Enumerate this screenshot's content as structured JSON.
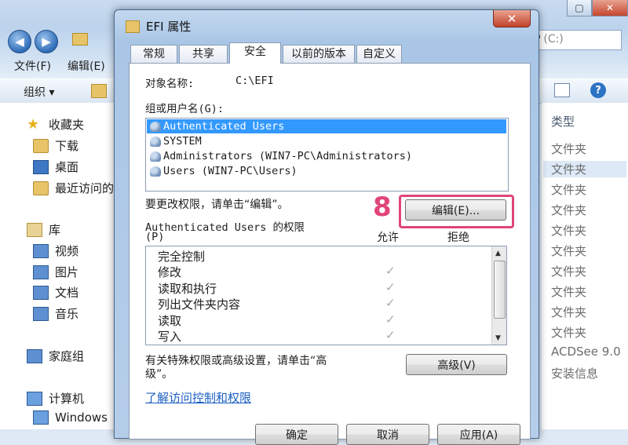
{
  "explorer": {
    "address_drive": "7 (C:)",
    "menu": [
      "文件(F)",
      "编辑(E)"
    ],
    "organize_label": "组织 ▾",
    "nav": {
      "favorites": "收藏夹",
      "downloads": "下载",
      "desktop": "桌面",
      "recent": "最近访问的",
      "libraries": "库",
      "videos": "视频",
      "pictures": "图片",
      "documents": "文档",
      "music": "音乐",
      "homegroup": "家庭组",
      "computer": "计算机",
      "windows": "Windows"
    },
    "type_header": "类型",
    "type_rows": [
      "文件夹",
      "文件夹",
      "文件夹",
      "文件夹",
      "文件夹",
      "文件夹",
      "文件夹",
      "文件夹",
      "文件夹",
      "文件夹",
      "ACDSee 9.0",
      "安装信息"
    ]
  },
  "dialog": {
    "title": "EFI 属性",
    "close": "✕",
    "tabs": [
      "常规",
      "共享",
      "安全",
      "以前的版本",
      "自定义"
    ],
    "object_name_label": "对象名称:",
    "object_name_value": "C:\\EFI",
    "group_label": "组或用户名(G):",
    "users": [
      "Authenticated Users",
      "SYSTEM",
      "Administrators (WIN7-PC\\Administrators)",
      "Users (WIN7-PC\\Users)"
    ],
    "change_hint": "要更改权限，请单击“编辑”。",
    "edit_button": "编辑(E)...",
    "step_marker": "8",
    "perm_for_line1": "Authenticated Users 的权限",
    "perm_for_line2": "(P)",
    "allow_header": "允许",
    "deny_header": "拒绝",
    "permissions": [
      {
        "name": "完全控制",
        "allow": ""
      },
      {
        "name": "修改",
        "allow": "✓"
      },
      {
        "name": "读取和执行",
        "allow": "✓"
      },
      {
        "name": "列出文件夹内容",
        "allow": "✓"
      },
      {
        "name": "读取",
        "allow": "✓"
      },
      {
        "name": "写入",
        "allow": "✓"
      }
    ],
    "special_hint_line1": "有关特殊权限或高级设置，请单击“高",
    "special_hint_line2": "级”。",
    "advanced_button": "高级(V)",
    "learn_link": "了解访问控制和权限",
    "ok_button": "确定",
    "cancel_button": "取消",
    "apply_button": "应用(A)"
  }
}
